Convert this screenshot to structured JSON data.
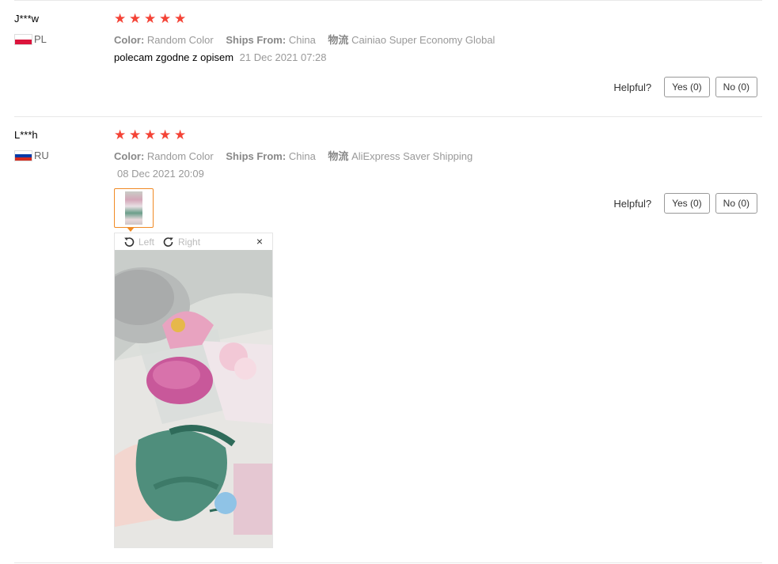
{
  "reviews": [
    {
      "user": "J***w",
      "country": "PL",
      "rating": 5,
      "attrs": {
        "color_label": "Color:",
        "color_value": "Random Color",
        "ships_label": "Ships From:",
        "ships_value": "China",
        "logistics_label": "物流",
        "logistics_value": "Cainiao Super Economy Global"
      },
      "text": "polecam zgodne z opisem",
      "date": "21 Dec 2021 07:28",
      "helpful": {
        "label": "Helpful?",
        "yes": "Yes (0)",
        "no": "No (0)"
      }
    },
    {
      "user": "L***h",
      "country": "RU",
      "rating": 5,
      "attrs": {
        "color_label": "Color:",
        "color_value": "Random Color",
        "ships_label": "Ships From:",
        "ships_value": "China",
        "logistics_label": "物流",
        "logistics_value": "AliExpress Saver Shipping"
      },
      "date": "08 Dec 2021 20:09",
      "helpful": {
        "label": "Helpful?",
        "yes": "Yes (0)",
        "no": "No (0)"
      },
      "viewer": {
        "left_label": "Left",
        "right_label": "Right",
        "close": "×"
      }
    }
  ],
  "star_glyph": "★",
  "colors": {
    "star": "#f44336",
    "thumb_border": "#f08a24"
  }
}
